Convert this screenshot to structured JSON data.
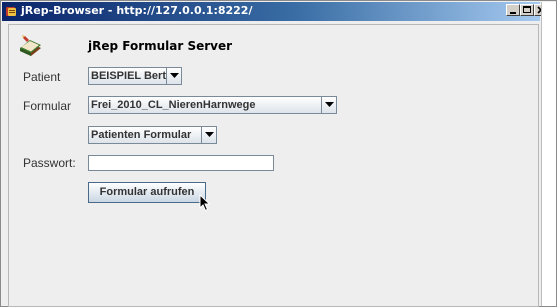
{
  "window": {
    "title": "jRep-Browser - http://127.0.0.1:8222/",
    "controls": [
      "minimize-icon",
      "maximize-icon",
      "close-icon"
    ],
    "title_gradient": [
      "#0a246a",
      "#a6caf0"
    ]
  },
  "header": {
    "app_icon": "book-icon",
    "title": "jRep Formular Server"
  },
  "form": {
    "patient_label": "Patient",
    "patient_value": "BEISPIEL Berta",
    "formular_label": "Formular",
    "formular_value": "Frei_2010_CL_NierenHarnwege",
    "form_type_value": "Patienten Formular",
    "password_label": "Passwort:",
    "password_value": "",
    "submit_label": "Formular aufrufen"
  },
  "colors": {
    "panel_background": "#eeeeee",
    "control_border": "#7a8a99"
  }
}
